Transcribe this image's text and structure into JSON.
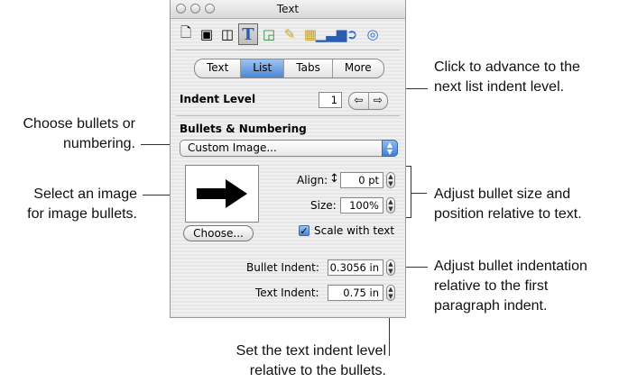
{
  "window": {
    "title": "Text",
    "toolbar_icons": [
      "document-icon",
      "layout-icon",
      "wrap-icon",
      "text-icon",
      "graphic-icon",
      "metrics-icon",
      "table-icon",
      "chart-icon",
      "link-icon",
      "qt-icon"
    ],
    "tabs": [
      {
        "label": "Text",
        "selected": false
      },
      {
        "label": "List",
        "selected": true
      },
      {
        "label": "Tabs",
        "selected": false
      },
      {
        "label": "More",
        "selected": false
      }
    ],
    "indent_level_label": "Indent Level",
    "indent_level_value": "1",
    "indent_arrow_left": "⇦",
    "indent_arrow_right": "⇨",
    "bullets_heading": "Bullets & Numbering",
    "popup_value": "Custom Image...",
    "align_label": "Align:",
    "align_value": "0 pt",
    "size_label": "Size:",
    "size_value": "100%",
    "choose_button": "Choose...",
    "scale_label": "Scale with text",
    "scale_checked": true,
    "bullet_indent_label": "Bullet Indent:",
    "bullet_indent_value": "0.3056 in",
    "text_indent_label": "Text Indent:",
    "text_indent_value": "0.75 in"
  },
  "callouts": {
    "advance_line1": "Click to advance to the",
    "advance_line2": "next list indent level.",
    "choose_line1": "Choose bullets or",
    "choose_line2": "numbering.",
    "select_line1": "Select an image",
    "select_line2": "for image bullets.",
    "adjust_size_line1": "Adjust bullet size and",
    "adjust_size_line2": "position relative to text.",
    "bullet_indent_line1": "Adjust bullet indentation",
    "bullet_indent_line2": "relative to the first",
    "bullet_indent_line3": "paragraph indent.",
    "text_indent_line1": "Set the text indent level",
    "text_indent_line2": "relative to the bullets."
  },
  "colors": {
    "selected_tab": "#4a86d6",
    "window_bg": "#f0f0f0"
  }
}
